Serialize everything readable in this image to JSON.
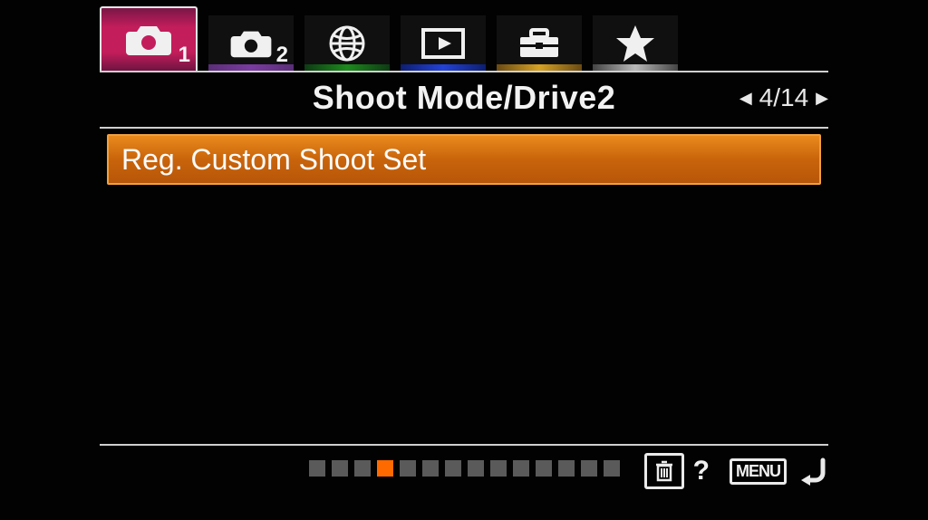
{
  "tabs": {
    "camera1_digit": "1",
    "camera2_digit": "2"
  },
  "title": "Shoot Mode/Drive2",
  "pager": {
    "current": "4",
    "total": "14",
    "display": "4/14"
  },
  "menu_items": [
    {
      "label": "Reg. Custom Shoot Set",
      "selected": true
    }
  ],
  "page_dots": {
    "count": 14,
    "active_index": 3
  },
  "bottom": {
    "menu_label": "MENU"
  }
}
